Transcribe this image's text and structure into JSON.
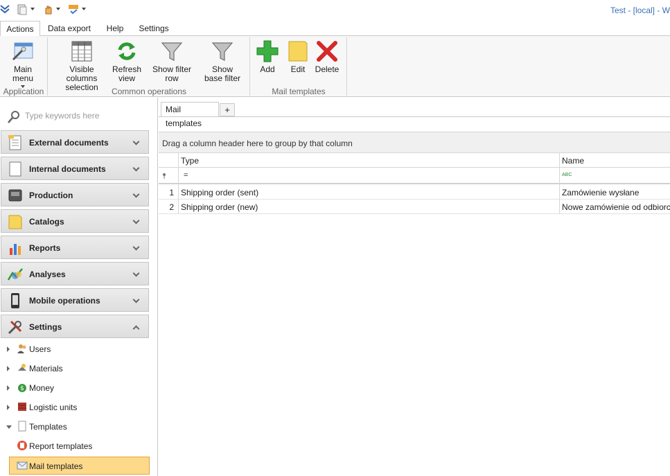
{
  "title_bar": {
    "title": "Test - [local] - W"
  },
  "ribbon_tabs": [
    {
      "label": "Actions",
      "active": true
    },
    {
      "label": "Data export"
    },
    {
      "label": "Help"
    },
    {
      "label": "Settings"
    }
  ],
  "ribbon": {
    "application": {
      "label": "Application",
      "main_menu": "Main menu"
    },
    "common": {
      "label": "Common operations",
      "visible_columns": "Visible columns selection",
      "refresh_view": "Refresh view",
      "show_filter_row": "Show filter row",
      "show_base_filter": "Show base filter"
    },
    "mail_templates": {
      "label": "Mail templates",
      "add": "Add",
      "edit": "Edit",
      "delete": "Delete"
    }
  },
  "nav": {
    "search_placeholder": "Type keywords here",
    "groups": [
      {
        "label": "External documents",
        "icon": "document-icon"
      },
      {
        "label": "Internal documents",
        "icon": "document-icon"
      },
      {
        "label": "Production",
        "icon": "machine-icon"
      },
      {
        "label": "Catalogs",
        "icon": "folder-icon"
      },
      {
        "label": "Reports",
        "icon": "bar-chart-icon"
      },
      {
        "label": "Analyses",
        "icon": "analysis-icon"
      },
      {
        "label": "Mobile operations",
        "icon": "phone-icon"
      },
      {
        "label": "Settings",
        "icon": "tools-icon",
        "expanded": true
      }
    ],
    "settings_items": [
      {
        "label": "Users",
        "icon": "users-icon"
      },
      {
        "label": "Materials",
        "icon": "materials-icon"
      },
      {
        "label": "Money",
        "icon": "money-icon"
      },
      {
        "label": "Logistic units",
        "icon": "pallet-icon"
      },
      {
        "label": "Templates",
        "icon": "template-icon",
        "expanded": true
      },
      {
        "label": "Report templates",
        "icon": "report-template-icon"
      },
      {
        "label": "Mail templates",
        "icon": "mail-icon",
        "selected": true
      }
    ]
  },
  "content": {
    "doc_tab": "Mail templates",
    "add_tab": "+",
    "group_panel_text": "Drag a column header here to group by that column",
    "columns": [
      "Type",
      "Name"
    ],
    "filter": {
      "type_operator": "=",
      "name_operator": "ABC"
    },
    "rows": [
      {
        "num": "1",
        "type": "Shipping order (sent)",
        "name": "Zamówienie wysłane"
      },
      {
        "num": "2",
        "type": "Shipping order (new)",
        "name": "Nowe zamówienie od odbiorcy"
      }
    ]
  },
  "colors": {
    "accent_blue": "#3b6fb6",
    "selected_bg": "#fdd98a",
    "selected_border": "#e2a33a"
  }
}
